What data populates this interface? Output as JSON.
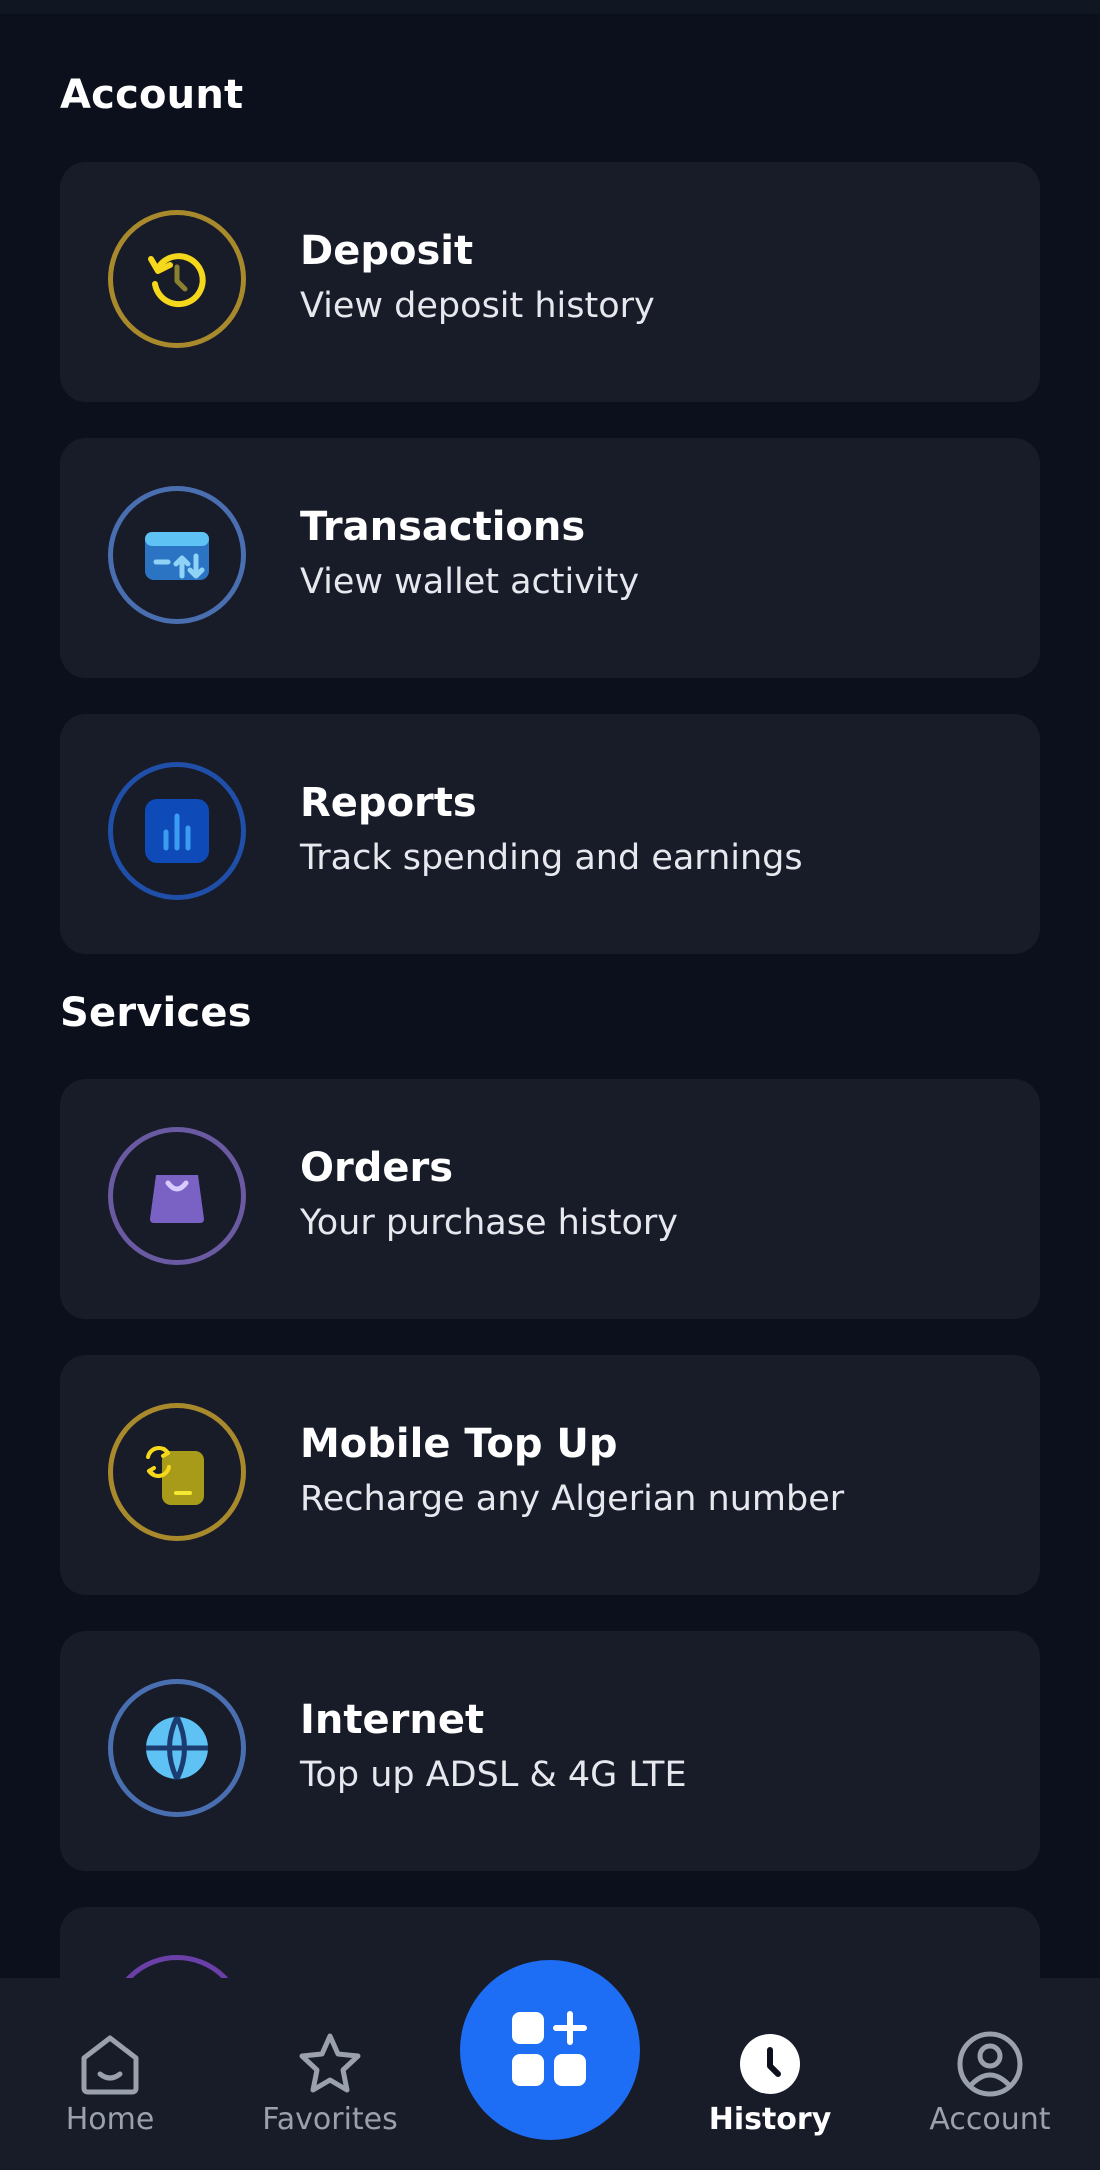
{
  "sections": {
    "account": {
      "title": "Account",
      "items": [
        {
          "title": "Deposit",
          "subtitle": "View deposit history",
          "icon": "deposit-history-icon",
          "ring_color": "#a88a2c"
        },
        {
          "title": "Transactions",
          "subtitle": "View wallet activity",
          "icon": "wallet-transactions-icon",
          "ring_color": "#4a6fb0"
        },
        {
          "title": "Reports",
          "subtitle": "Track spending and earnings",
          "icon": "bar-chart-icon",
          "ring_color": "#1f4fa8"
        }
      ]
    },
    "services": {
      "title": "Services",
      "items": [
        {
          "title": "Orders",
          "subtitle": "Your purchase history",
          "icon": "shopping-bag-icon",
          "ring_color": "#6a5aa2"
        },
        {
          "title": "Mobile Top Up",
          "subtitle": "Recharge any Algerian number",
          "icon": "mobile-topup-icon",
          "ring_color": "#a88a2c"
        },
        {
          "title": "Internet",
          "subtitle": "Top up ADSL & 4G LTE",
          "icon": "globe-icon",
          "ring_color": "#4a6fb0"
        }
      ]
    }
  },
  "nav": {
    "home": "Home",
    "favorites": "Favorites",
    "history": "History",
    "account": "Account",
    "active": "History",
    "fab_icon": "add-service-icon"
  },
  "colors": {
    "background": "#0b101c",
    "card": "#181c29",
    "accent": "#1e6ef5"
  }
}
